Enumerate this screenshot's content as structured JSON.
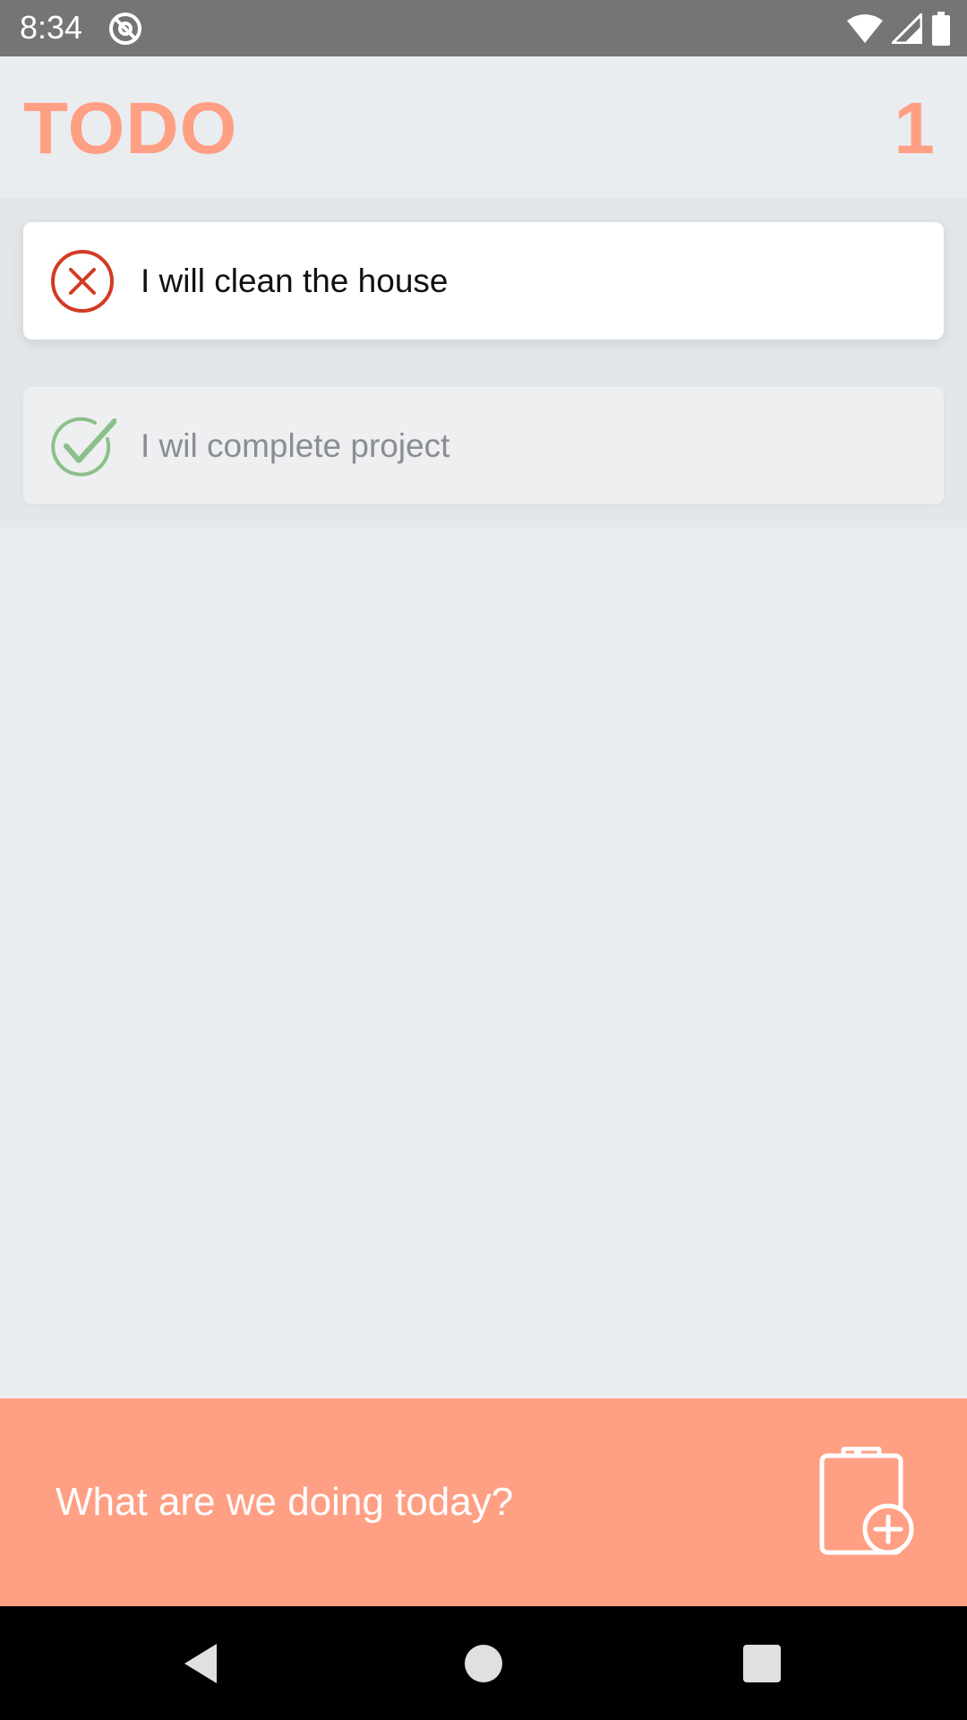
{
  "status_bar": {
    "time": "8:34",
    "icons": [
      "at-sign-icon",
      "wifi-icon",
      "signal-icon",
      "battery-icon"
    ]
  },
  "header": {
    "title": "TODO",
    "count": "1"
  },
  "tasks": [
    {
      "text": "I will clean the house",
      "status": "pending",
      "icon": "close-circle-icon"
    },
    {
      "text": "I wil complete project",
      "status": "done",
      "icon": "check-circle-icon"
    }
  ],
  "composer": {
    "placeholder": "What are we doing today?",
    "button_icon": "clipboard-add-icon"
  },
  "nav": {
    "buttons": [
      "back-icon",
      "home-icon",
      "recents-icon"
    ]
  },
  "colors": {
    "accent": "#ff9f84",
    "background": "#e9edf0",
    "pending_icon": "#d23b25",
    "done_icon": "#8cc08a"
  }
}
